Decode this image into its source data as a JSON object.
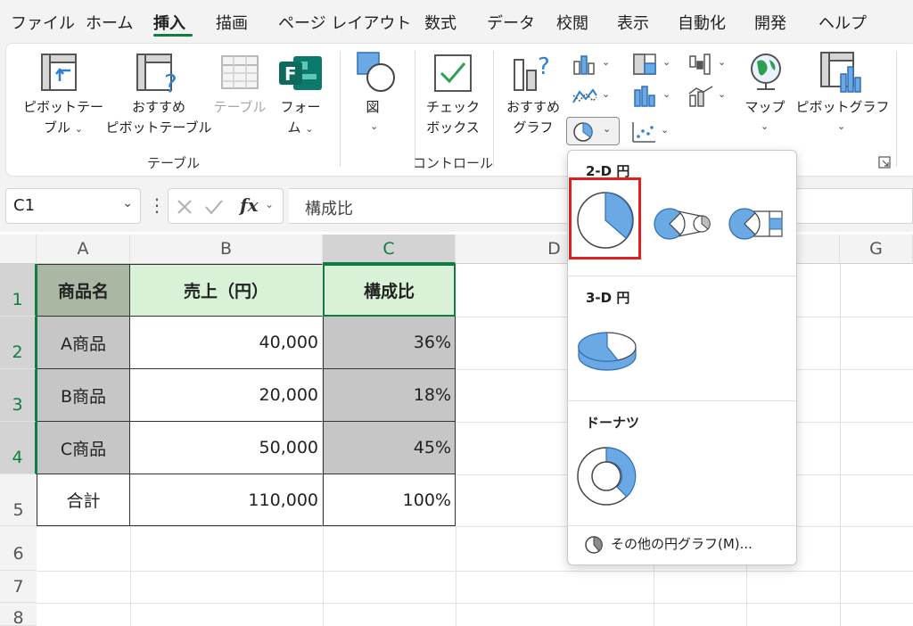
{
  "menu": {
    "tabs": [
      {
        "label": "ファイル"
      },
      {
        "label": "ホーム"
      },
      {
        "label": "挿入"
      },
      {
        "label": "描画"
      },
      {
        "label": "ページ レイアウト"
      },
      {
        "label": "数式"
      },
      {
        "label": "データ"
      },
      {
        "label": "校閲"
      },
      {
        "label": "表示"
      },
      {
        "label": "自動化"
      },
      {
        "label": "開発"
      },
      {
        "label": "ヘルプ"
      }
    ],
    "active_tab": "挿入",
    "accent_color": "#107c41"
  },
  "ribbon": {
    "pivot_table": {
      "line1": "ピボットテー",
      "line2": "ブル"
    },
    "recommended_pivot": {
      "line1": "おすすめ",
      "line2": "ピボットテーブル"
    },
    "table": {
      "label": "テーブル"
    },
    "forms": {
      "line1": "フォー",
      "line2": "ム"
    },
    "illustrations": {
      "label": "図"
    },
    "checkbox": {
      "line1": "チェック",
      "line2": "ボックス"
    },
    "recommended_charts": {
      "line1": "おすすめ",
      "line2": "グラフ"
    },
    "maps": {
      "label": "マップ"
    },
    "pivot_chart": {
      "label": "ピボットグラフ"
    },
    "groups": {
      "tables": "テーブル",
      "controls": "コントロール"
    }
  },
  "formula_bar": {
    "name_box": "C1",
    "fx": "fx",
    "value": "構成比"
  },
  "sheet": {
    "columns": [
      "A",
      "B",
      "C",
      "D",
      "G"
    ],
    "rows": [
      "1",
      "2",
      "3",
      "4",
      "5",
      "6",
      "7",
      "8"
    ],
    "header": {
      "a": "商品名",
      "b": "売上（円）",
      "c": "構成比"
    },
    "data": [
      {
        "a": "A商品",
        "b": "40,000",
        "c": "36%"
      },
      {
        "a": "B商品",
        "b": "20,000",
        "c": "18%"
      },
      {
        "a": "C商品",
        "b": "50,000",
        "c": "45%"
      }
    ],
    "total": {
      "a": "合計",
      "b": "110,000",
      "c": "100%"
    }
  },
  "pie_menu": {
    "section_2d": "2-D 円",
    "section_3d": "3-D 円",
    "section_donut": "ドーナツ",
    "more": "その他の円グラフ(M)...",
    "highlight_color": "#e0201e",
    "pie_color": "#6aa9e3"
  }
}
